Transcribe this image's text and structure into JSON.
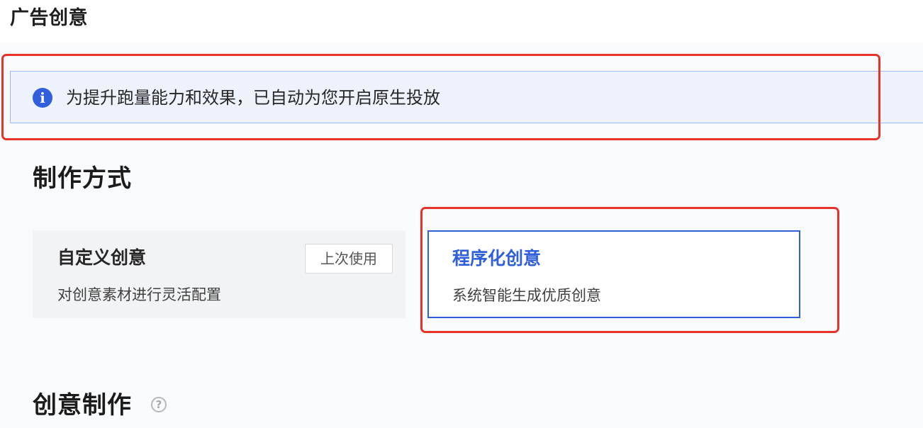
{
  "page": {
    "title": "广告创意"
  },
  "notice": {
    "icon": "info-icon",
    "icon_glyph": "i",
    "text": "为提升跑量能力和效果，已自动为您开启原生投放",
    "accent_color": "#2f5fdb",
    "background_color": "#edf2fc"
  },
  "production_method": {
    "title": "制作方式",
    "options": [
      {
        "title": "自定义创意",
        "description": "对创意素材进行灵活配置",
        "badge": "上次使用",
        "selected": false
      },
      {
        "title": "程序化创意",
        "description": "系统智能生成优质创意",
        "badge": "",
        "selected": true
      }
    ]
  },
  "creative_production": {
    "title": "创意制作",
    "help_icon": "question-circle-icon",
    "help_glyph": "?"
  },
  "annotations": {
    "highlight_color": "#e5332a"
  }
}
